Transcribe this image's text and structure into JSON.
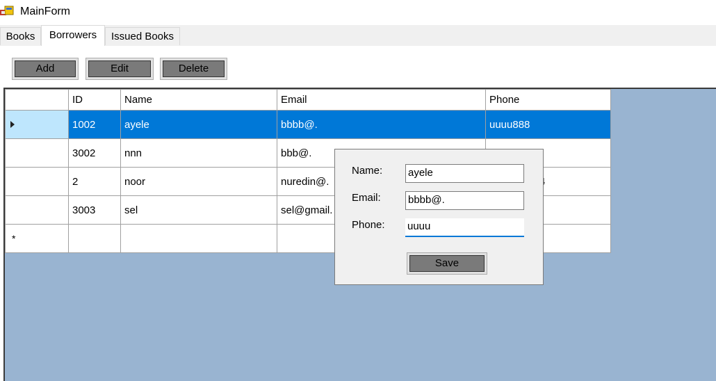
{
  "window": {
    "title": "MainForm"
  },
  "tabs": [
    {
      "label": "Books"
    },
    {
      "label": "Borrowers"
    },
    {
      "label": "Issued Books"
    }
  ],
  "toolbar": {
    "add_label": "Add",
    "edit_label": "Edit",
    "delete_label": "Delete"
  },
  "grid": {
    "columns": [
      "ID",
      "Name",
      "Email",
      "Phone"
    ],
    "rows": [
      {
        "id": "1002",
        "name": "ayele",
        "email": "bbbb@.",
        "phone": "uuuu888",
        "selected": true
      },
      {
        "id": "3002",
        "name": "nnn",
        "email": "bbb@.",
        "phone": ""
      },
      {
        "id": "2",
        "name": "noor",
        "email": "nuredin@.",
        "phone": "4"
      },
      {
        "id": "3003",
        "name": "sel",
        "email": "sel@gmail.",
        "phone": ""
      }
    ],
    "new_row_marker": "*"
  },
  "edit_panel": {
    "name_label": "Name:",
    "email_label": "Email:",
    "phone_label": "Phone:",
    "name_value": "ayele",
    "email_value": "bbbb@.",
    "phone_value": "uuuu",
    "save_label": "Save"
  },
  "colors": {
    "selection": "#0078d7",
    "grid_background": "#99b4d1",
    "row_header_selected": "#bee6fd"
  }
}
